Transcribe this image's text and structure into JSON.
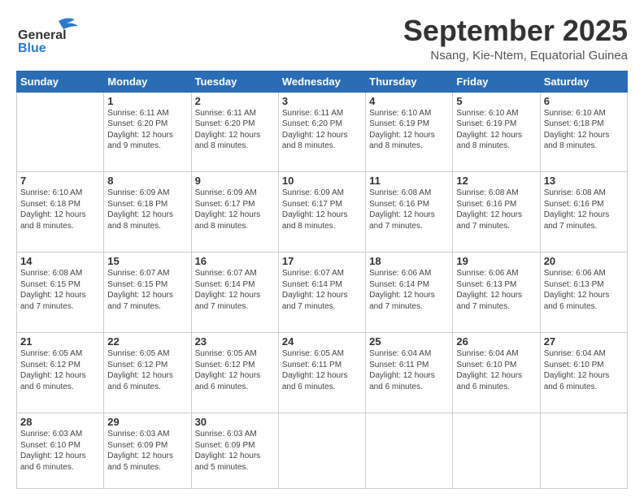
{
  "header": {
    "logo_general": "General",
    "logo_blue": "Blue",
    "month_title": "September 2025",
    "subtitle": "Nsang, Kie-Ntem, Equatorial Guinea"
  },
  "weekdays": [
    "Sunday",
    "Monday",
    "Tuesday",
    "Wednesday",
    "Thursday",
    "Friday",
    "Saturday"
  ],
  "weeks": [
    [
      {
        "day": "",
        "info": ""
      },
      {
        "day": "1",
        "info": "Sunrise: 6:11 AM\nSunset: 6:20 PM\nDaylight: 12 hours\nand 9 minutes."
      },
      {
        "day": "2",
        "info": "Sunrise: 6:11 AM\nSunset: 6:20 PM\nDaylight: 12 hours\nand 8 minutes."
      },
      {
        "day": "3",
        "info": "Sunrise: 6:11 AM\nSunset: 6:20 PM\nDaylight: 12 hours\nand 8 minutes."
      },
      {
        "day": "4",
        "info": "Sunrise: 6:10 AM\nSunset: 6:19 PM\nDaylight: 12 hours\nand 8 minutes."
      },
      {
        "day": "5",
        "info": "Sunrise: 6:10 AM\nSunset: 6:19 PM\nDaylight: 12 hours\nand 8 minutes."
      },
      {
        "day": "6",
        "info": "Sunrise: 6:10 AM\nSunset: 6:18 PM\nDaylight: 12 hours\nand 8 minutes."
      }
    ],
    [
      {
        "day": "7",
        "info": "Sunrise: 6:10 AM\nSunset: 6:18 PM\nDaylight: 12 hours\nand 8 minutes."
      },
      {
        "day": "8",
        "info": "Sunrise: 6:09 AM\nSunset: 6:18 PM\nDaylight: 12 hours\nand 8 minutes."
      },
      {
        "day": "9",
        "info": "Sunrise: 6:09 AM\nSunset: 6:17 PM\nDaylight: 12 hours\nand 8 minutes."
      },
      {
        "day": "10",
        "info": "Sunrise: 6:09 AM\nSunset: 6:17 PM\nDaylight: 12 hours\nand 8 minutes."
      },
      {
        "day": "11",
        "info": "Sunrise: 6:08 AM\nSunset: 6:16 PM\nDaylight: 12 hours\nand 7 minutes."
      },
      {
        "day": "12",
        "info": "Sunrise: 6:08 AM\nSunset: 6:16 PM\nDaylight: 12 hours\nand 7 minutes."
      },
      {
        "day": "13",
        "info": "Sunrise: 6:08 AM\nSunset: 6:16 PM\nDaylight: 12 hours\nand 7 minutes."
      }
    ],
    [
      {
        "day": "14",
        "info": "Sunrise: 6:08 AM\nSunset: 6:15 PM\nDaylight: 12 hours\nand 7 minutes."
      },
      {
        "day": "15",
        "info": "Sunrise: 6:07 AM\nSunset: 6:15 PM\nDaylight: 12 hours\nand 7 minutes."
      },
      {
        "day": "16",
        "info": "Sunrise: 6:07 AM\nSunset: 6:14 PM\nDaylight: 12 hours\nand 7 minutes."
      },
      {
        "day": "17",
        "info": "Sunrise: 6:07 AM\nSunset: 6:14 PM\nDaylight: 12 hours\nand 7 minutes."
      },
      {
        "day": "18",
        "info": "Sunrise: 6:06 AM\nSunset: 6:14 PM\nDaylight: 12 hours\nand 7 minutes."
      },
      {
        "day": "19",
        "info": "Sunrise: 6:06 AM\nSunset: 6:13 PM\nDaylight: 12 hours\nand 7 minutes."
      },
      {
        "day": "20",
        "info": "Sunrise: 6:06 AM\nSunset: 6:13 PM\nDaylight: 12 hours\nand 6 minutes."
      }
    ],
    [
      {
        "day": "21",
        "info": "Sunrise: 6:05 AM\nSunset: 6:12 PM\nDaylight: 12 hours\nand 6 minutes."
      },
      {
        "day": "22",
        "info": "Sunrise: 6:05 AM\nSunset: 6:12 PM\nDaylight: 12 hours\nand 6 minutes."
      },
      {
        "day": "23",
        "info": "Sunrise: 6:05 AM\nSunset: 6:12 PM\nDaylight: 12 hours\nand 6 minutes."
      },
      {
        "day": "24",
        "info": "Sunrise: 6:05 AM\nSunset: 6:11 PM\nDaylight: 12 hours\nand 6 minutes."
      },
      {
        "day": "25",
        "info": "Sunrise: 6:04 AM\nSunset: 6:11 PM\nDaylight: 12 hours\nand 6 minutes."
      },
      {
        "day": "26",
        "info": "Sunrise: 6:04 AM\nSunset: 6:10 PM\nDaylight: 12 hours\nand 6 minutes."
      },
      {
        "day": "27",
        "info": "Sunrise: 6:04 AM\nSunset: 6:10 PM\nDaylight: 12 hours\nand 6 minutes."
      }
    ],
    [
      {
        "day": "28",
        "info": "Sunrise: 6:03 AM\nSunset: 6:10 PM\nDaylight: 12 hours\nand 6 minutes."
      },
      {
        "day": "29",
        "info": "Sunrise: 6:03 AM\nSunset: 6:09 PM\nDaylight: 12 hours\nand 5 minutes."
      },
      {
        "day": "30",
        "info": "Sunrise: 6:03 AM\nSunset: 6:09 PM\nDaylight: 12 hours\nand 5 minutes."
      },
      {
        "day": "",
        "info": ""
      },
      {
        "day": "",
        "info": ""
      },
      {
        "day": "",
        "info": ""
      },
      {
        "day": "",
        "info": ""
      }
    ]
  ]
}
